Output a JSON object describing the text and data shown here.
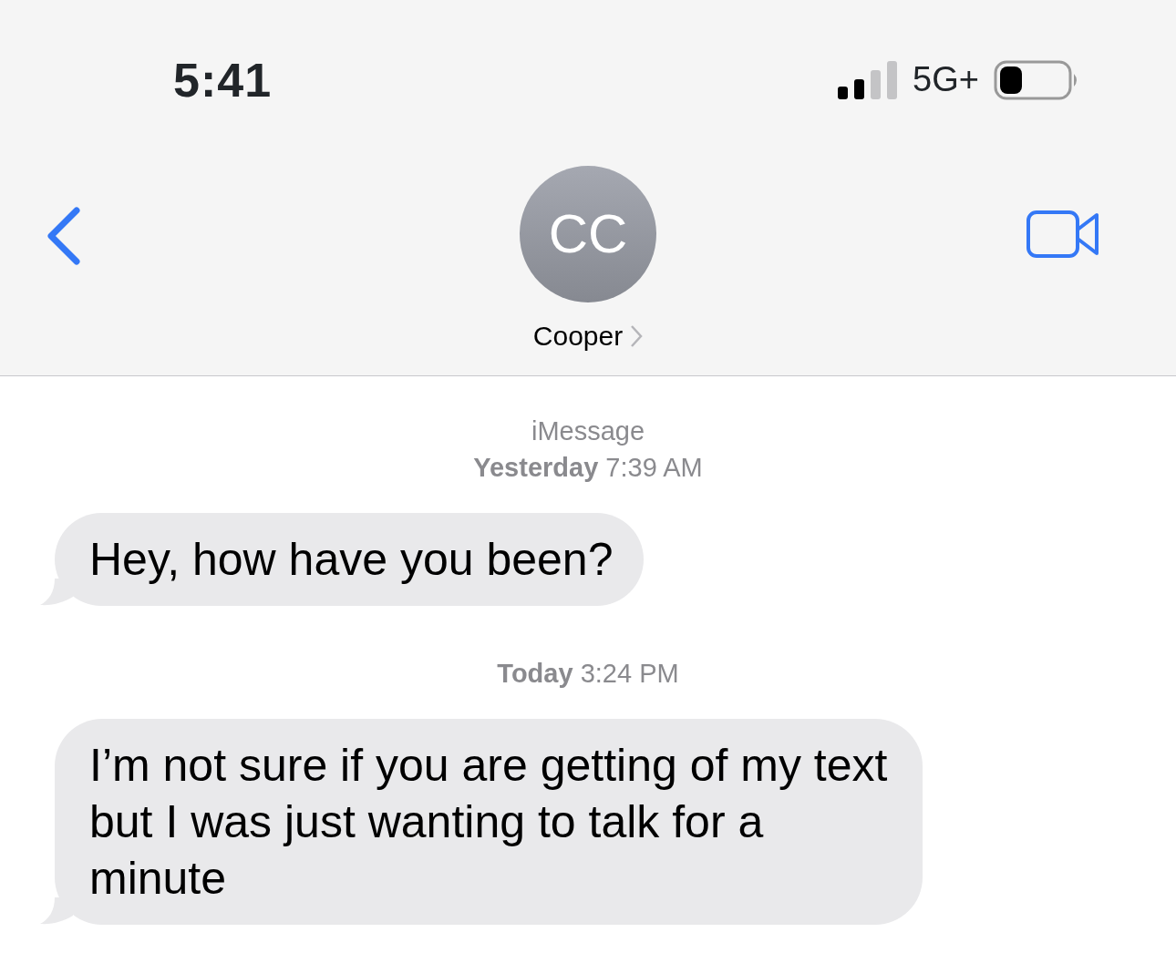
{
  "status_bar": {
    "time": "5:41",
    "network": "5G+"
  },
  "header": {
    "initials": "CC",
    "name": "Cooper"
  },
  "conversation": {
    "service": "iMessage",
    "items": [
      {
        "kind": "timestamp",
        "text": "**Yesterday** 7:39 AM"
      },
      {
        "kind": "received",
        "text": "Hey, how have you been?"
      },
      {
        "kind": "timestamp",
        "text": "**Today** 3:24 PM"
      },
      {
        "kind": "received",
        "text": "I’m not sure if you are getting of my text but I was just wanting to talk for a minute"
      }
    ]
  }
}
